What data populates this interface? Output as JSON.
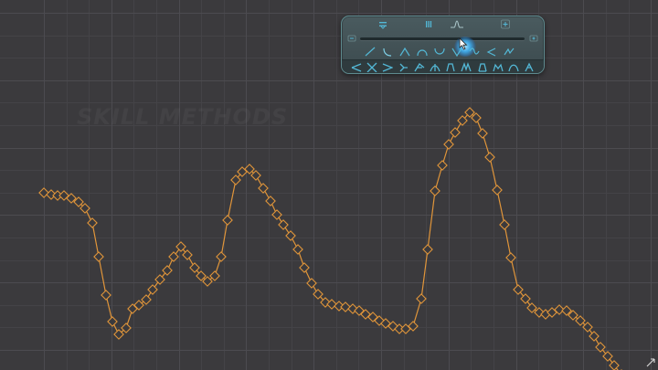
{
  "watermark": {
    "text": "SKILL METHODS"
  },
  "colors": {
    "background": "#3b3a3d",
    "grid_minor": "#444347",
    "grid_major": "#4c4b50",
    "curve": "#e0953a",
    "palette_bg": "#45565a",
    "palette_icon": "#53b8d6",
    "knob_glow": "#5fc2ff"
  },
  "palette": {
    "top_icons": [
      "flatten-icon",
      "pause-bars-icon",
      "bell-curve-icon",
      "plus-icon"
    ],
    "slider": {
      "value": 0.64,
      "left_icon": "minus-icon",
      "right_icon": "plus-icon"
    },
    "shape_icons": [
      "linear-icon",
      "ease-in-icon",
      "bump-up-icon",
      "arch-icon",
      "dip-icon",
      "valley-icon",
      "wave-icon",
      "chevron-left-icon",
      "peak-icon"
    ],
    "preset_icons": [
      "preset-1-icon",
      "preset-2-icon",
      "preset-3-icon",
      "preset-4-icon",
      "preset-5-icon",
      "preset-6-icon",
      "preset-7-icon",
      "preset-8-icon",
      "preset-9-icon",
      "preset-10-icon",
      "preset-11-icon",
      "preset-12-icon"
    ]
  }
}
